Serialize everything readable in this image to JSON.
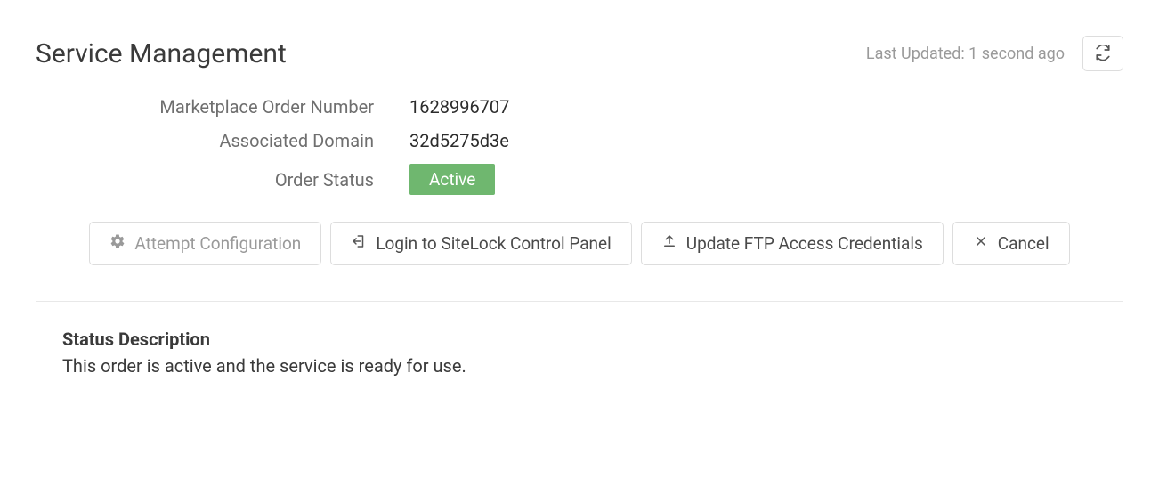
{
  "header": {
    "title": "Service Management",
    "last_updated": "Last Updated: 1 second ago"
  },
  "details": {
    "order_number_label": "Marketplace Order Number",
    "order_number_value": "1628996707",
    "domain_label": "Associated Domain",
    "domain_value": "32d5275d3e",
    "status_label": "Order Status",
    "status_badge": "Active"
  },
  "buttons": {
    "attempt_configuration": "Attempt Configuration",
    "login_sitelock": "Login to SiteLock Control Panel",
    "update_ftp": "Update FTP Access Credentials",
    "cancel": "Cancel"
  },
  "status_description": {
    "title": "Status Description",
    "text": "This order is active and the service is ready for use."
  },
  "colors": {
    "badge_bg": "#6fb76f"
  }
}
